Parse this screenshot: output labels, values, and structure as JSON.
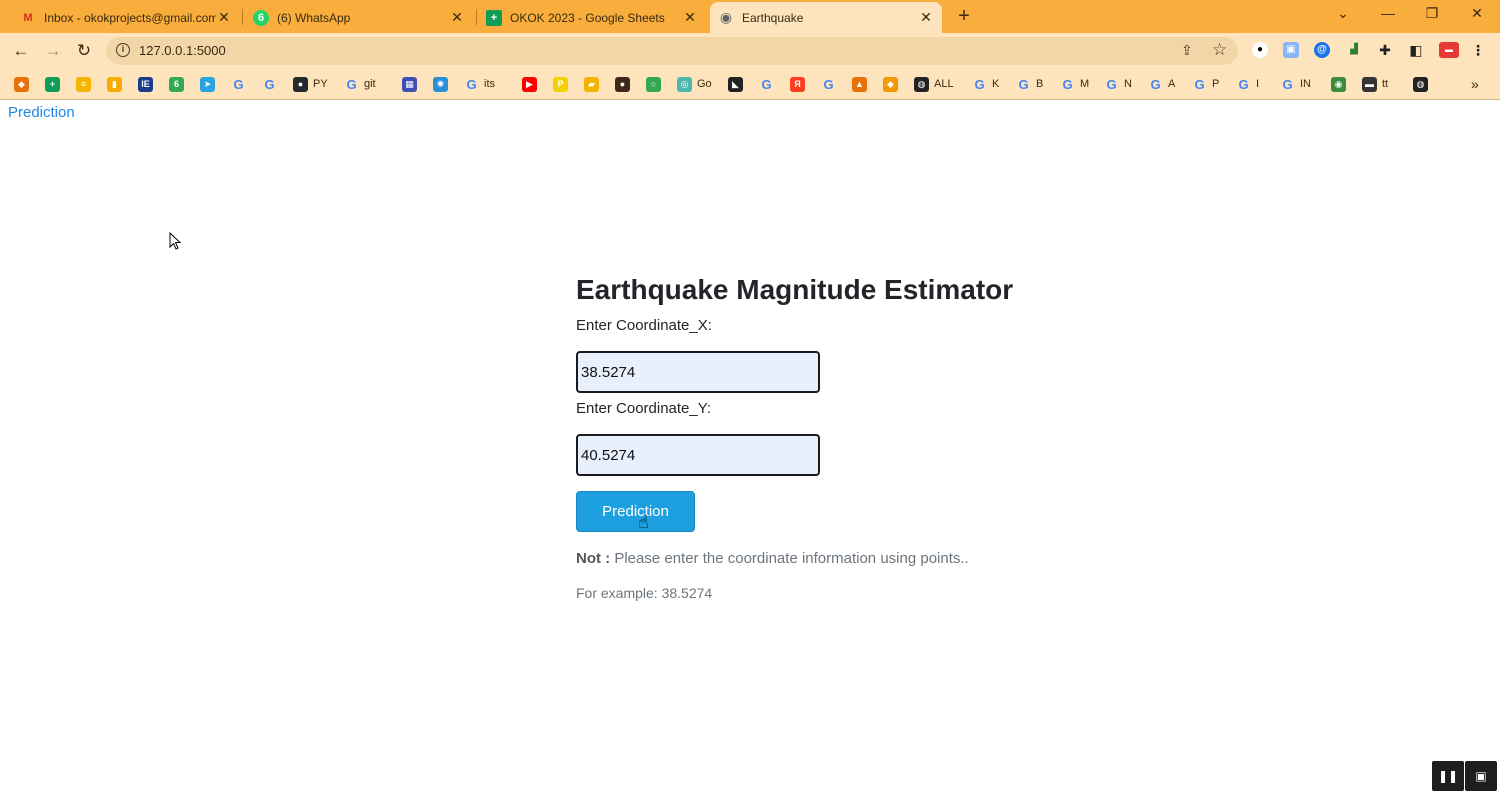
{
  "tabs": [
    {
      "title": "Inbox - okokprojects@gmail.com",
      "favicon": "gmail-icon",
      "fav_text": "M",
      "color": "#d93025"
    },
    {
      "title": "(6) WhatsApp",
      "favicon": "whatsapp-icon",
      "fav_text": "6",
      "color": "#25d366"
    },
    {
      "title": "OKOK 2023 - Google Sheets",
      "favicon": "sheets-icon",
      "fav_text": "+",
      "color": "#0f9d58"
    },
    {
      "title": "Earthquake",
      "favicon": "globe-icon",
      "fav_text": "◉",
      "color": "#5f6368"
    }
  ],
  "address_bar": {
    "url": "127.0.0.1:5000"
  },
  "bookmarks": [
    {
      "label": "",
      "color": "#e8710a",
      "text": "◆"
    },
    {
      "label": "",
      "color": "#0f9d58",
      "text": "+"
    },
    {
      "label": "",
      "color": "#f4b400",
      "text": "≡"
    },
    {
      "label": "",
      "color": "#f9ab00",
      "text": "▮"
    },
    {
      "label": "",
      "color": "#1a3c8c",
      "text": "IE"
    },
    {
      "label": "",
      "color": "#34a853",
      "text": "6"
    },
    {
      "label": "",
      "color": "#2aa3e0",
      "text": "➤"
    },
    {
      "label": "",
      "color": "",
      "text": "G"
    },
    {
      "label": "",
      "color": "",
      "text": "G"
    },
    {
      "label": "PY",
      "color": "#24292e",
      "text": "●"
    },
    {
      "label": "git",
      "color": "",
      "text": "G"
    },
    {
      "label": "",
      "color": "#3f51b5",
      "text": "▦"
    },
    {
      "label": "",
      "color": "#2a8fd6",
      "text": "✺"
    },
    {
      "label": "its",
      "color": "",
      "text": "G"
    },
    {
      "label": "",
      "color": "#ff0000",
      "text": "▶"
    },
    {
      "label": "",
      "color": "#f5d000",
      "text": "P"
    },
    {
      "label": "",
      "color": "#f4b400",
      "text": "▰"
    },
    {
      "label": "",
      "color": "#3c2a18",
      "text": "●"
    },
    {
      "label": "",
      "color": "#34a853",
      "text": "○"
    },
    {
      "label": "Go",
      "color": "#4fb7b0",
      "text": "◎"
    },
    {
      "label": "",
      "color": "#222222",
      "text": "◣"
    },
    {
      "label": "",
      "color": "",
      "text": "G"
    },
    {
      "label": "",
      "color": "#fc3f1d",
      "text": "Я"
    },
    {
      "label": "",
      "color": "",
      "text": "G"
    },
    {
      "label": "",
      "color": "#e8710a",
      "text": "▲"
    },
    {
      "label": "",
      "color": "#f29900",
      "text": "◆"
    },
    {
      "label": "ALL",
      "color": "#222222",
      "text": "◍"
    },
    {
      "label": "K",
      "color": "",
      "text": "G"
    },
    {
      "label": "B",
      "color": "",
      "text": "G"
    },
    {
      "label": "M",
      "color": "",
      "text": "G"
    },
    {
      "label": "N",
      "color": "",
      "text": "G"
    },
    {
      "label": "A",
      "color": "",
      "text": "G"
    },
    {
      "label": "P",
      "color": "",
      "text": "G"
    },
    {
      "label": "I",
      "color": "",
      "text": "G"
    },
    {
      "label": "IN",
      "color": "",
      "text": "G"
    },
    {
      "label": "",
      "color": "#3c8c3c",
      "text": "◉"
    },
    {
      "label": "tt",
      "color": "#333333",
      "text": "▬"
    },
    {
      "label": "",
      "color": "#222222",
      "text": "◍"
    }
  ],
  "page": {
    "nav_link": "Prediction",
    "title": "Earthquake Magnitude Estimator",
    "label_x": "Enter Coordinate_X:",
    "value_x": "38.5274",
    "label_y": "Enter Coordinate_Y:",
    "value_y": "40.5274",
    "button": "Prediction",
    "note_bold": "Not :",
    "note_text": "Please enter the coordinate information using points..",
    "example": "For example: 38.5274"
  }
}
